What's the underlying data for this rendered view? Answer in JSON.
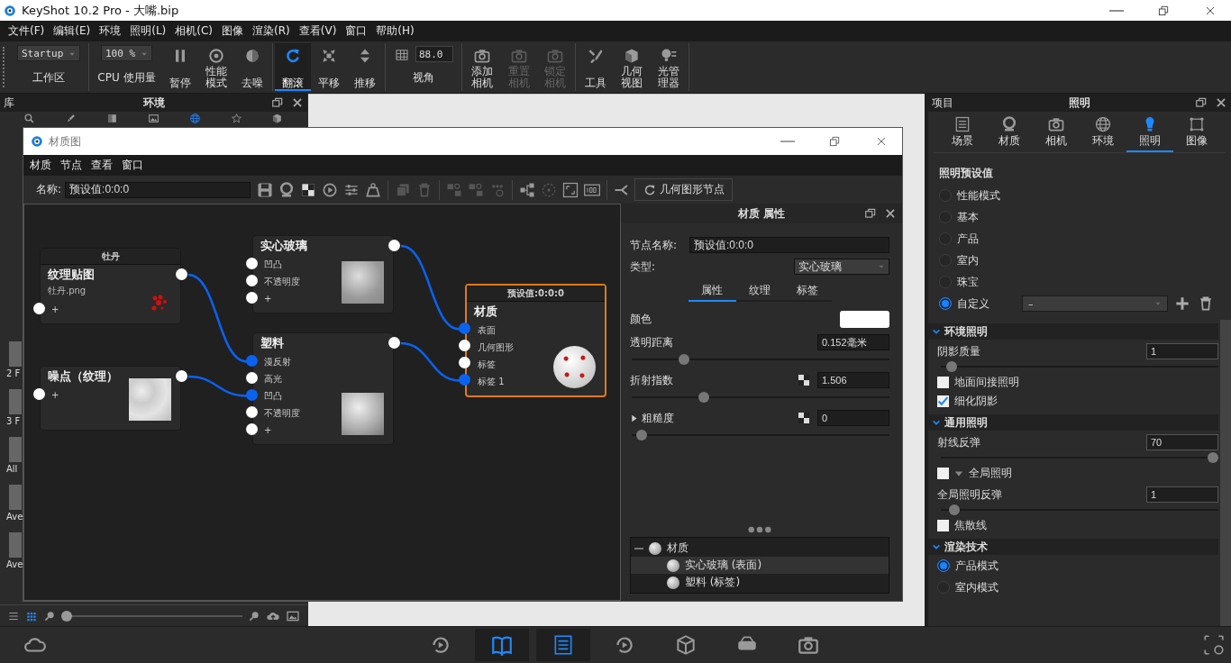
{
  "app_title": "KeyShot 10.2 Pro  - 大嘴.bip",
  "menu": [
    "文件(F)",
    "编辑(E)",
    "环境",
    "照明(L)",
    "相机(C)",
    "图像",
    "渲染(R)",
    "查看(V)",
    "窗口",
    "帮助(H)"
  ],
  "toolbar": [
    [
      {
        "kind": "dropdown",
        "value": "Startup",
        "label": "工作区"
      }
    ],
    [
      {
        "kind": "dropdown",
        "value": "100 %",
        "label": "CPU 使用量"
      },
      {
        "kind": "button",
        "label": "暂停",
        "selected": false,
        "disabled": false
      },
      {
        "kind": "button",
        "label": "性能模式",
        "selected": false,
        "disabled": false
      },
      {
        "kind": "button",
        "label": "去噪",
        "selected": false,
        "disabled": false
      }
    ],
    [
      {
        "kind": "button",
        "label": "翻滚",
        "selected": true,
        "disabled": false
      },
      {
        "kind": "button",
        "label": "平移",
        "selected": false,
        "disabled": false
      },
      {
        "kind": "button",
        "label": "推移",
        "selected": false,
        "disabled": false
      }
    ],
    [
      {
        "kind": "field",
        "value": "88.0",
        "label": "视角"
      }
    ],
    [
      {
        "kind": "button",
        "label": "添加相机",
        "selected": false,
        "disabled": false
      },
      {
        "kind": "button",
        "label": "重置相机",
        "selected": false,
        "disabled": true
      },
      {
        "kind": "button",
        "label": "锁定相机",
        "selected": false,
        "disabled": true
      }
    ],
    [
      {
        "kind": "button",
        "label": "工具",
        "selected": false,
        "disabled": false
      },
      {
        "kind": "button",
        "label": "几何视图",
        "selected": false,
        "disabled": false
      },
      {
        "kind": "button",
        "label": "光管理器",
        "selected": false,
        "disabled": false
      }
    ]
  ],
  "library": {
    "title": "库",
    "tab_title": "环境",
    "items": [
      "2 F",
      "3 F",
      "All",
      "Ave",
      "Ave"
    ],
    "zoom": {
      "level": 0
    }
  },
  "material_window": {
    "title": "材质图",
    "menu": [
      "材质",
      "节点",
      "查看",
      "窗口"
    ],
    "name_label": "名称:",
    "name_value": "预设值:0:0:0",
    "geometry_button": "几何图形节点",
    "nodes": [
      {
        "kind": "texture",
        "header": "牡丹",
        "title": "纹理贴图",
        "subtitle": "牡丹.png",
        "selected": false,
        "ports": [
          {
            "label": "+",
            "connected": false
          }
        ]
      },
      {
        "kind": "texture",
        "title": "噪点（纹理）",
        "selected": false,
        "ports": [
          {
            "label": "+",
            "connected": false
          }
        ]
      },
      {
        "kind": "material",
        "title": "实心玻璃",
        "selected": false,
        "ports": [
          {
            "label": "凹凸",
            "connected": false
          },
          {
            "label": "不透明度",
            "connected": false
          },
          {
            "label": "+",
            "connected": false
          }
        ]
      },
      {
        "kind": "material",
        "title": "塑料",
        "selected": false,
        "ports": [
          {
            "label": "漫反射",
            "connected": true
          },
          {
            "label": "高光",
            "connected": false
          },
          {
            "label": "凹凸",
            "connected": true
          },
          {
            "label": "不透明度",
            "connected": false
          },
          {
            "label": "+",
            "connected": false
          }
        ]
      },
      {
        "kind": "output",
        "header": "预设值:0:0:0",
        "title": "材质",
        "selected": true,
        "ports": [
          {
            "label": "表面",
            "connected": true
          },
          {
            "label": "几何图形",
            "connected": false
          },
          {
            "label": "标签",
            "connected": false
          },
          {
            "label": "标签 1",
            "connected": true
          }
        ]
      }
    ],
    "properties": {
      "title": "材质 属性",
      "node_name_label": "节点名称:",
      "node_name": "预设值:0:0:0",
      "type_label": "类型:",
      "type_value": "实心玻璃",
      "tabs": [
        {
          "label": "属性",
          "selected": true
        },
        {
          "label": "纹理",
          "selected": false
        },
        {
          "label": "标签",
          "selected": false
        }
      ],
      "params": [
        {
          "kind": "color",
          "label": "颜色"
        },
        {
          "kind": "slider",
          "label": "透明距离",
          "value": "0.152毫米",
          "level": 0.19
        },
        {
          "kind": "slider",
          "label": "折射指数",
          "value": "1.506",
          "level": 0.27,
          "texture": true
        },
        {
          "kind": "slider",
          "label": "粗糙度",
          "value": "0",
          "level": 0.02,
          "texture": true,
          "expandable": true
        }
      ],
      "tree": [
        {
          "label": "材质",
          "expanded": true,
          "selected": false,
          "children": [
            {
              "label": "实心玻璃 (表面)",
              "selected": true
            },
            {
              "label": "塑料 (标签)",
              "selected": false
            }
          ]
        }
      ]
    }
  },
  "project": {
    "header": "项目",
    "title": "照明",
    "tabs": [
      {
        "label": "场景",
        "selected": false
      },
      {
        "label": "材质",
        "selected": false
      },
      {
        "label": "相机",
        "selected": false
      },
      {
        "label": "环境",
        "selected": false
      },
      {
        "label": "照明",
        "selected": true
      },
      {
        "label": "图像",
        "selected": false
      }
    ],
    "preset_title": "照明预设值",
    "presets": [
      {
        "label": "性能模式",
        "selected": false
      },
      {
        "label": "基本",
        "selected": false
      },
      {
        "label": "产品",
        "selected": false
      },
      {
        "label": "室内",
        "selected": false
      },
      {
        "label": "珠宝",
        "selected": false
      },
      {
        "label": "自定义",
        "selected": true,
        "dropdown": "–"
      }
    ],
    "sections": [
      {
        "title": "环境照明",
        "expanded": true,
        "rows": [
          {
            "kind": "slider",
            "label": "阴影质量",
            "value": "1",
            "level": 0.02
          },
          {
            "kind": "checkbox",
            "label": "地面间接照明",
            "checked": false
          },
          {
            "kind": "checkbox",
            "label": "细化阴影",
            "checked": true
          }
        ]
      },
      {
        "title": "通用照明",
        "expanded": true,
        "rows": [
          {
            "kind": "slider",
            "label": "射线反弹",
            "value": "70",
            "level": 1
          },
          {
            "kind": "checkbox",
            "label": "全局照明",
            "checked": false,
            "expandable": true
          },
          {
            "kind": "slider",
            "label": "全局照明反弹",
            "value": "1",
            "level": 0.03
          },
          {
            "kind": "checkbox",
            "label": "焦散线",
            "checked": false
          }
        ]
      },
      {
        "title": "渲染技术",
        "expanded": true,
        "rows": [
          {
            "kind": "radio",
            "label": "产品模式",
            "selected": true
          },
          {
            "kind": "radio",
            "label": "室内模式",
            "selected": false
          }
        ]
      }
    ]
  }
}
